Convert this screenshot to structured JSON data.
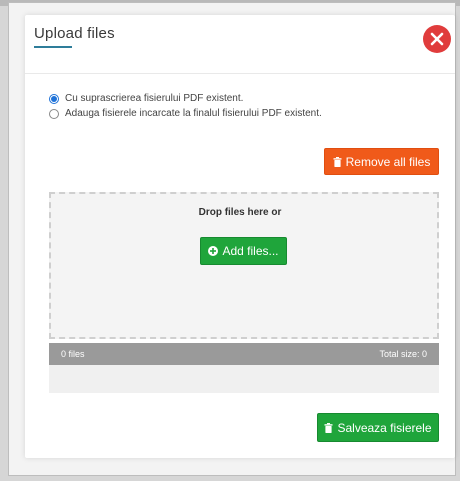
{
  "dialog": {
    "title": "Upload files"
  },
  "options": [
    {
      "label": "Cu suprascrierea fisierului PDF existent.",
      "checked": true
    },
    {
      "label": "Adauga fisierele incarcate la finalul fisierului PDF existent.",
      "checked": false
    }
  ],
  "toolbar": {
    "remove_all_label": "Remove all files"
  },
  "dropzone": {
    "prompt": "Drop files here or",
    "add_files_label": "Add files..."
  },
  "status": {
    "files_count": "0 files",
    "total_size": "Total size: 0"
  },
  "footer": {
    "save_label": "Salveaza fisierele"
  },
  "colors": {
    "close": "#e03c3c",
    "remove": "#f05a1a",
    "success": "#1fa53b",
    "radio": "#1f72d8"
  }
}
